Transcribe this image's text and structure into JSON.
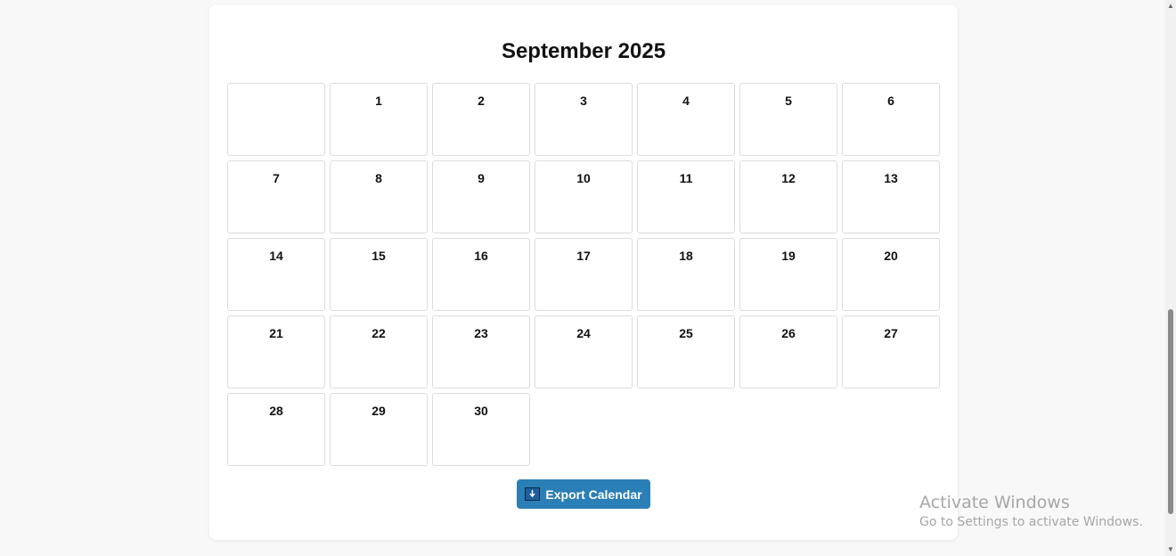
{
  "calendar": {
    "title": "September 2025",
    "cells": [
      "",
      "1",
      "2",
      "3",
      "4",
      "5",
      "6",
      "7",
      "8",
      "9",
      "10",
      "11",
      "12",
      "13",
      "14",
      "15",
      "16",
      "17",
      "18",
      "19",
      "20",
      "21",
      "22",
      "23",
      "24",
      "25",
      "26",
      "27",
      "28",
      "29",
      "30"
    ]
  },
  "export": {
    "label": "Export Calendar",
    "icon": "download-icon",
    "color": "#2b7fb7"
  },
  "watermark": {
    "title": "Activate Windows",
    "subtitle": "Go to Settings to activate Windows."
  }
}
